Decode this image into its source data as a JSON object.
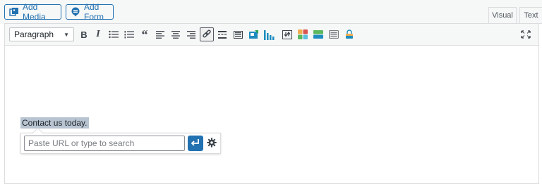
{
  "media_buttons": {
    "add_media_label": "Add Media",
    "add_form_label": "Add Form"
  },
  "editor_tabs": {
    "visual_label": "Visual",
    "text_label": "Text",
    "active": "Visual"
  },
  "toolbar": {
    "format_select_value": "Paragraph",
    "bold_glyph": "B",
    "italic_glyph": "I",
    "blockquote_glyph": "“",
    "buttons": [
      "bold",
      "italic",
      "bulleted-list",
      "numbered-list",
      "blockquote",
      "align-left",
      "align-center",
      "align-right",
      "insert-link",
      "read-more",
      "toolbar-toggle",
      "plugin-1",
      "plugin-chart",
      "plugin-download",
      "plugin-grid",
      "plugin-bar",
      "plugin-list",
      "plugin-lock",
      "fullscreen"
    ],
    "pressed": "insert-link"
  },
  "content": {
    "selected_text": "Contact us today."
  },
  "link_popup": {
    "url_placeholder": "Paste URL or type to search",
    "url_value": ""
  },
  "colors": {
    "accent": "#2271b1",
    "selection": "#b8c4d2",
    "toolbar_bg": "#f6f7f7",
    "border": "#dcdcde"
  }
}
